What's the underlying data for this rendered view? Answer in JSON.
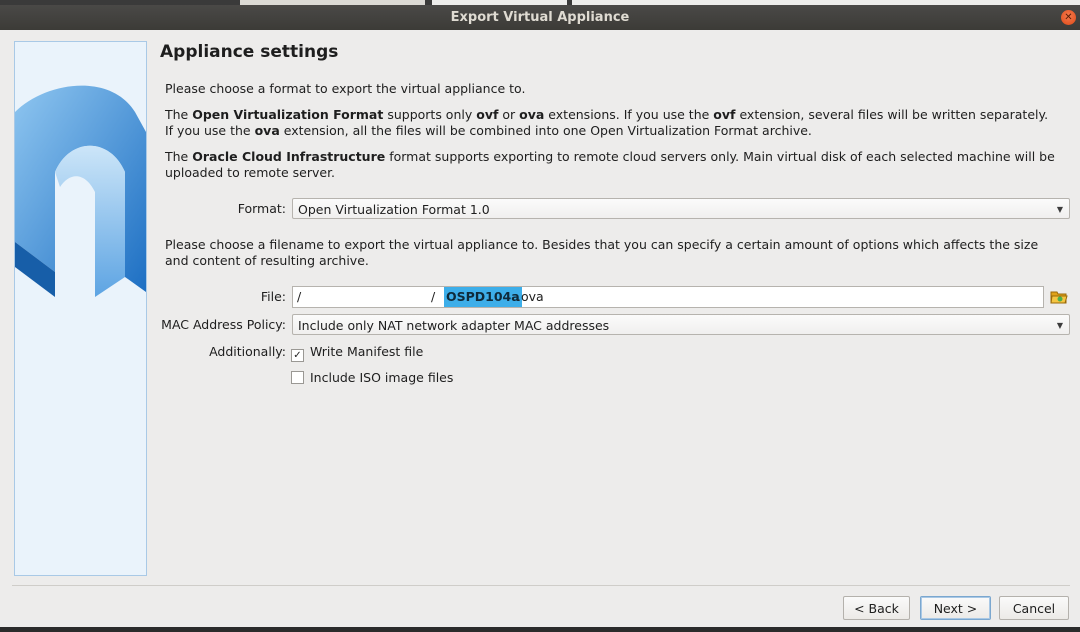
{
  "window": {
    "title": "Export Virtual Appliance",
    "close_glyph": "✕"
  },
  "page": {
    "heading": "Appliance settings",
    "intro": "Please choose a format to export the virtual appliance to.",
    "ovf_para": {
      "p1": "The ",
      "b1": "Open Virtualization Format",
      "p2": " supports only ",
      "b2": "ovf",
      "p3": " or ",
      "b3": "ova",
      "p4": " extensions. If you use the ",
      "b4": "ovf",
      "p5": " extension, several files will be written separately. If you use the ",
      "b5": "ova",
      "p6": " extension, all the files will be combined into one Open Virtualization Format archive."
    },
    "oci_para": {
      "p1": "The ",
      "b1": "Oracle Cloud Infrastructure",
      "p2": " format supports exporting to remote cloud servers only. Main virtual disk of each selected machine will be uploaded to remote server."
    },
    "format_label": "Format:",
    "format_value": "Open Virtualization Format 1.0",
    "filename_para": "Please choose a filename to export the virtual appliance to. Besides that you can specify a certain amount of options which affects the size and content of resulting archive.",
    "file_label": "File:",
    "file": {
      "slash1": "/",
      "slash2": "/",
      "selected": "OSPD104a",
      "extension": ".ova"
    },
    "mac_label": "MAC Address Policy:",
    "mac_value": "Include only NAT network adapter MAC addresses",
    "additionally_label": "Additionally:",
    "options": [
      {
        "label": "Write Manifest file",
        "checked": true,
        "glyph": "✓"
      },
      {
        "label": "Include ISO image files",
        "checked": false,
        "glyph": ""
      }
    ],
    "dropdown_glyph": "▼"
  },
  "buttons": {
    "back": "< Back",
    "next": "Next >",
    "cancel": "Cancel"
  },
  "colors": {
    "selection": "#3daee9",
    "accent": "#df4a16",
    "titlebar": "#3c3b37"
  },
  "icons": {
    "side": "virtualbox-export-graphic",
    "folder": "folder-open-icon",
    "close": "close-icon"
  }
}
